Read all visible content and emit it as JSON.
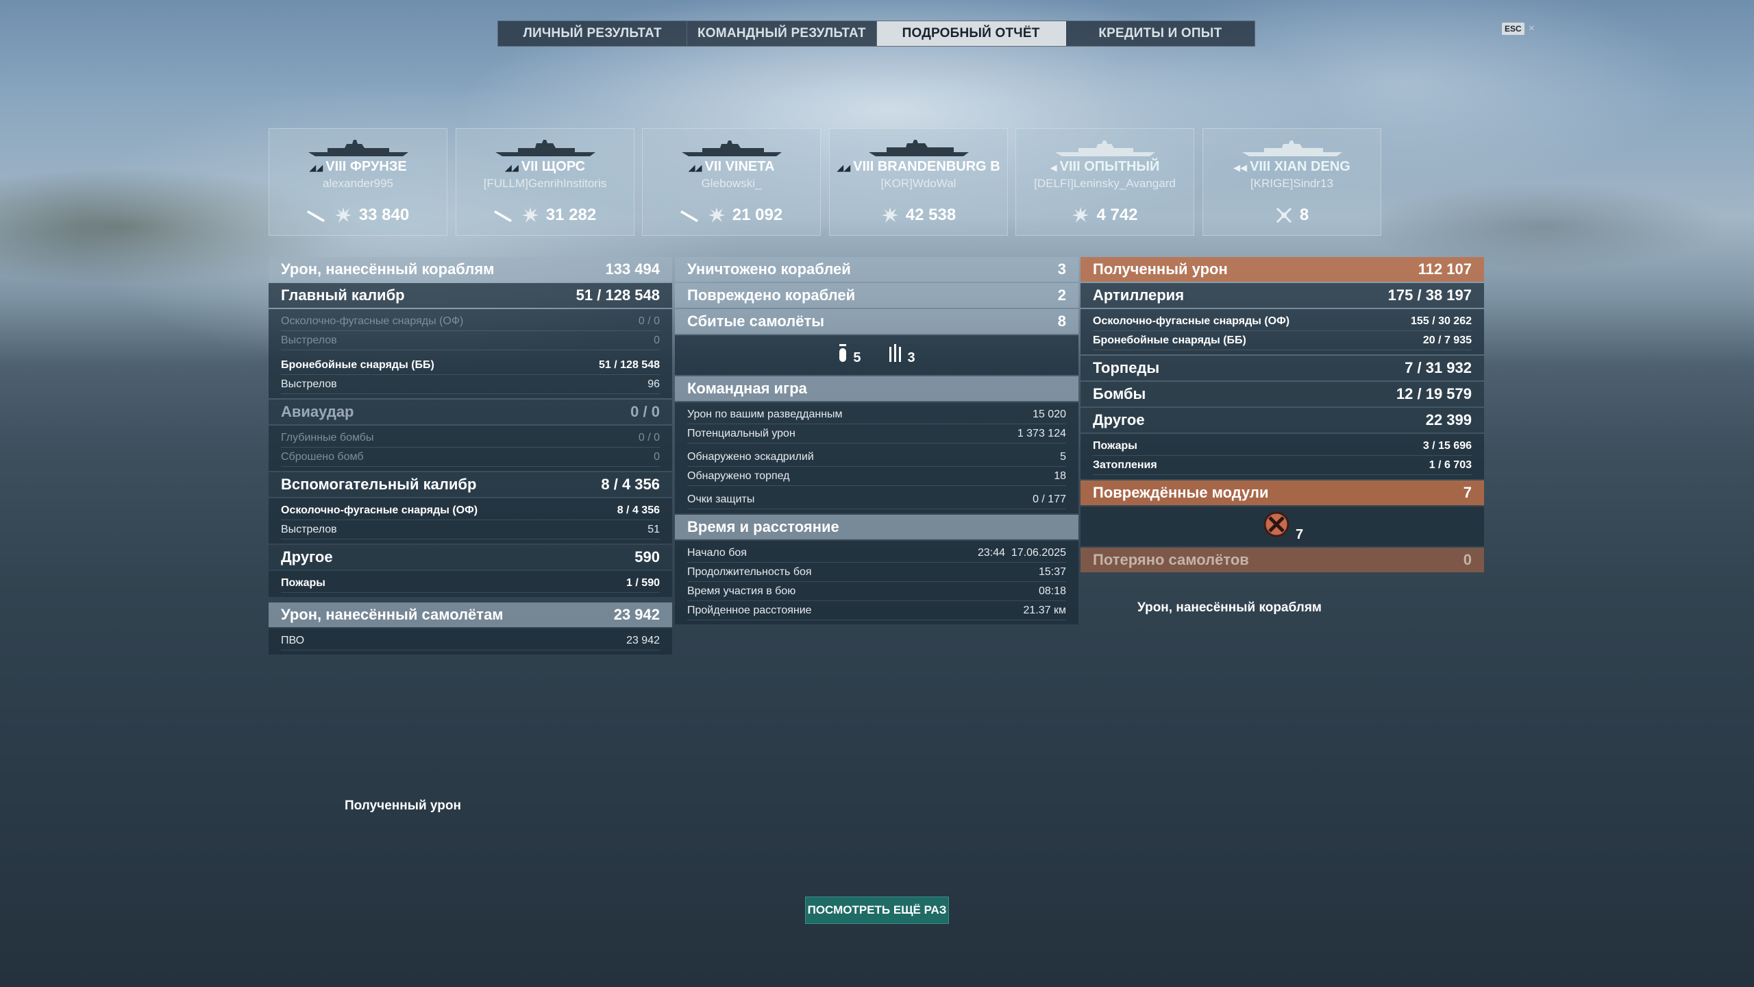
{
  "tabs": [
    {
      "label": "ЛИЧНЫЙ РЕЗУЛЬТАТ",
      "active": false
    },
    {
      "label": "КОМАНДНЫЙ РЕЗУЛЬТАТ",
      "active": false
    },
    {
      "label": "ПОДРОБНЫЙ ОТЧЁТ",
      "active": true
    },
    {
      "label": "КРЕДИТЫ И ОПЫТ",
      "active": false
    }
  ],
  "esc": {
    "key": "ESC",
    "close": "×"
  },
  "ships": [
    {
      "tier": "VIII",
      "name": "ФРУНЗЕ",
      "player": "alexander995",
      "value": "33 840",
      "icons": [
        "torpedo-icon",
        "explosion-icon"
      ]
    },
    {
      "tier": "VII",
      "name": "ЩОРС",
      "player": "[FULLM]GenrihInstitoris",
      "value": "31 282",
      "icons": [
        "torpedo-icon",
        "explosion-icon"
      ]
    },
    {
      "tier": "VII",
      "name": "VINETA",
      "player": "Glebowski_",
      "value": "21 092",
      "icons": [
        "torpedo-icon",
        "explosion-icon"
      ]
    },
    {
      "tier": "VIII",
      "name": "BRANDENBURG B",
      "player": "[KOR]WdoWal",
      "value": "42 538",
      "icons": [
        "explosion-icon"
      ]
    },
    {
      "tier": "VIII",
      "name": "ОПЫТНЫЙ",
      "player": "[DELFI]Leninsky_Avangard",
      "value": "4 742",
      "icons": [
        "explosion-icon"
      ]
    },
    {
      "tier": "VIII",
      "name": "XIAN DENG",
      "player": "[KRIGE]Sindr13",
      "value": "8",
      "icons": [
        "plane-down-icon"
      ]
    }
  ],
  "left": {
    "damage": {
      "label": "Урон, нанесённый кораблям",
      "value": "133 494"
    },
    "main": {
      "label": "Главный калибр",
      "hits": "51",
      "dmg": "128 548"
    },
    "he": {
      "label": "Осколочно-фугасные снаряды (ОФ)",
      "hits": "0",
      "dmg": "0"
    },
    "he_shots": {
      "label": "Выстрелов",
      "value": "0"
    },
    "ap": {
      "label": "Бронебойные снаряды (ББ)",
      "hits": "51",
      "dmg": "128 548"
    },
    "ap_shots": {
      "label": "Выстрелов",
      "value": "96"
    },
    "air": {
      "label": "Авиаудар",
      "hits": "0",
      "dmg": "0"
    },
    "depth": {
      "label": "Глубинные бомбы",
      "hits": "0",
      "dmg": "0"
    },
    "dropped": {
      "label": "Сброшено бомб",
      "value": "0"
    },
    "secondary": {
      "label": "Вспомогательный калибр",
      "hits": "8",
      "dmg": "4 356"
    },
    "sec_he": {
      "label": "Осколочно-фугасные снаряды (ОФ)",
      "hits": "8",
      "dmg": "4 356"
    },
    "sec_shots": {
      "label": "Выстрелов",
      "value": "51"
    },
    "other": {
      "label": "Другое",
      "value": "590"
    },
    "fires": {
      "label": "Пожары",
      "hits": "1",
      "dmg": "590"
    },
    "planes_dmg": {
      "label": "Урон, нанесённый самолётам",
      "value": "23 942"
    },
    "aa": {
      "label": "ПВО",
      "value": "23 942"
    }
  },
  "mid": {
    "destroyed": {
      "label": "Уничтожено кораблей",
      "value": "3"
    },
    "damaged": {
      "label": "Повреждено кораблей",
      "value": "2"
    },
    "planes": {
      "label": "Сбитые самолёты",
      "value": "8"
    },
    "planes_a": "5",
    "planes_b": "3",
    "team": {
      "label": "Командная игра"
    },
    "spot_dmg": {
      "label": "Урон по вашим разведданным",
      "value": "15 020"
    },
    "potential": {
      "label": "Потенциальный урон",
      "value": "1 373 124"
    },
    "squadrons": {
      "label": "Обнаружено эскадрилий",
      "value": "5"
    },
    "torps": {
      "label": "Обнаружено торпед",
      "value": "18"
    },
    "defense": {
      "label": "Очки защиты",
      "value": "0 / 177"
    },
    "time": {
      "label": "Время и расстояние"
    },
    "start": {
      "label": "Начало боя",
      "value": "23:44  17.06.2025"
    },
    "duration": {
      "label": "Продолжительность боя",
      "value": "15:37"
    },
    "participation": {
      "label": "Время участия в бою",
      "value": "08:18"
    },
    "distance": {
      "label": "Пройденное расстояние",
      "value": "21.37 км"
    }
  },
  "right": {
    "received": {
      "label": "Полученный урон",
      "value": "112 107"
    },
    "artillery": {
      "label": "Артиллерия",
      "hits": "175",
      "dmg": "38 197"
    },
    "he": {
      "label": "Осколочно-фугасные снаряды (ОФ)",
      "hits": "155",
      "dmg": "30 262"
    },
    "ap": {
      "label": "Бронебойные снаряды (ББ)",
      "hits": "20",
      "dmg": "7 935"
    },
    "torpedoes": {
      "label": "Торпеды",
      "hits": "7",
      "dmg": "31 932"
    },
    "bombs": {
      "label": "Бомбы",
      "hits": "12",
      "dmg": "19 579"
    },
    "other": {
      "label": "Другое",
      "value": "22 399"
    },
    "fires": {
      "label": "Пожары",
      "hits": "3",
      "dmg": "15 696"
    },
    "flood": {
      "label": "Затопления",
      "hits": "1",
      "dmg": "6 703"
    },
    "modules": {
      "label": "Повреждённые модули",
      "value": "7"
    },
    "modules_count": "7",
    "lost": {
      "label": "Потеряно самолётов",
      "value": "0"
    }
  },
  "captions": {
    "damage_ships": "Урон, нанесённый кораблям",
    "received": "Полученный урон"
  },
  "replay": {
    "label": "ПОСМОТРЕТЬ ЕЩЁ РАЗ"
  }
}
